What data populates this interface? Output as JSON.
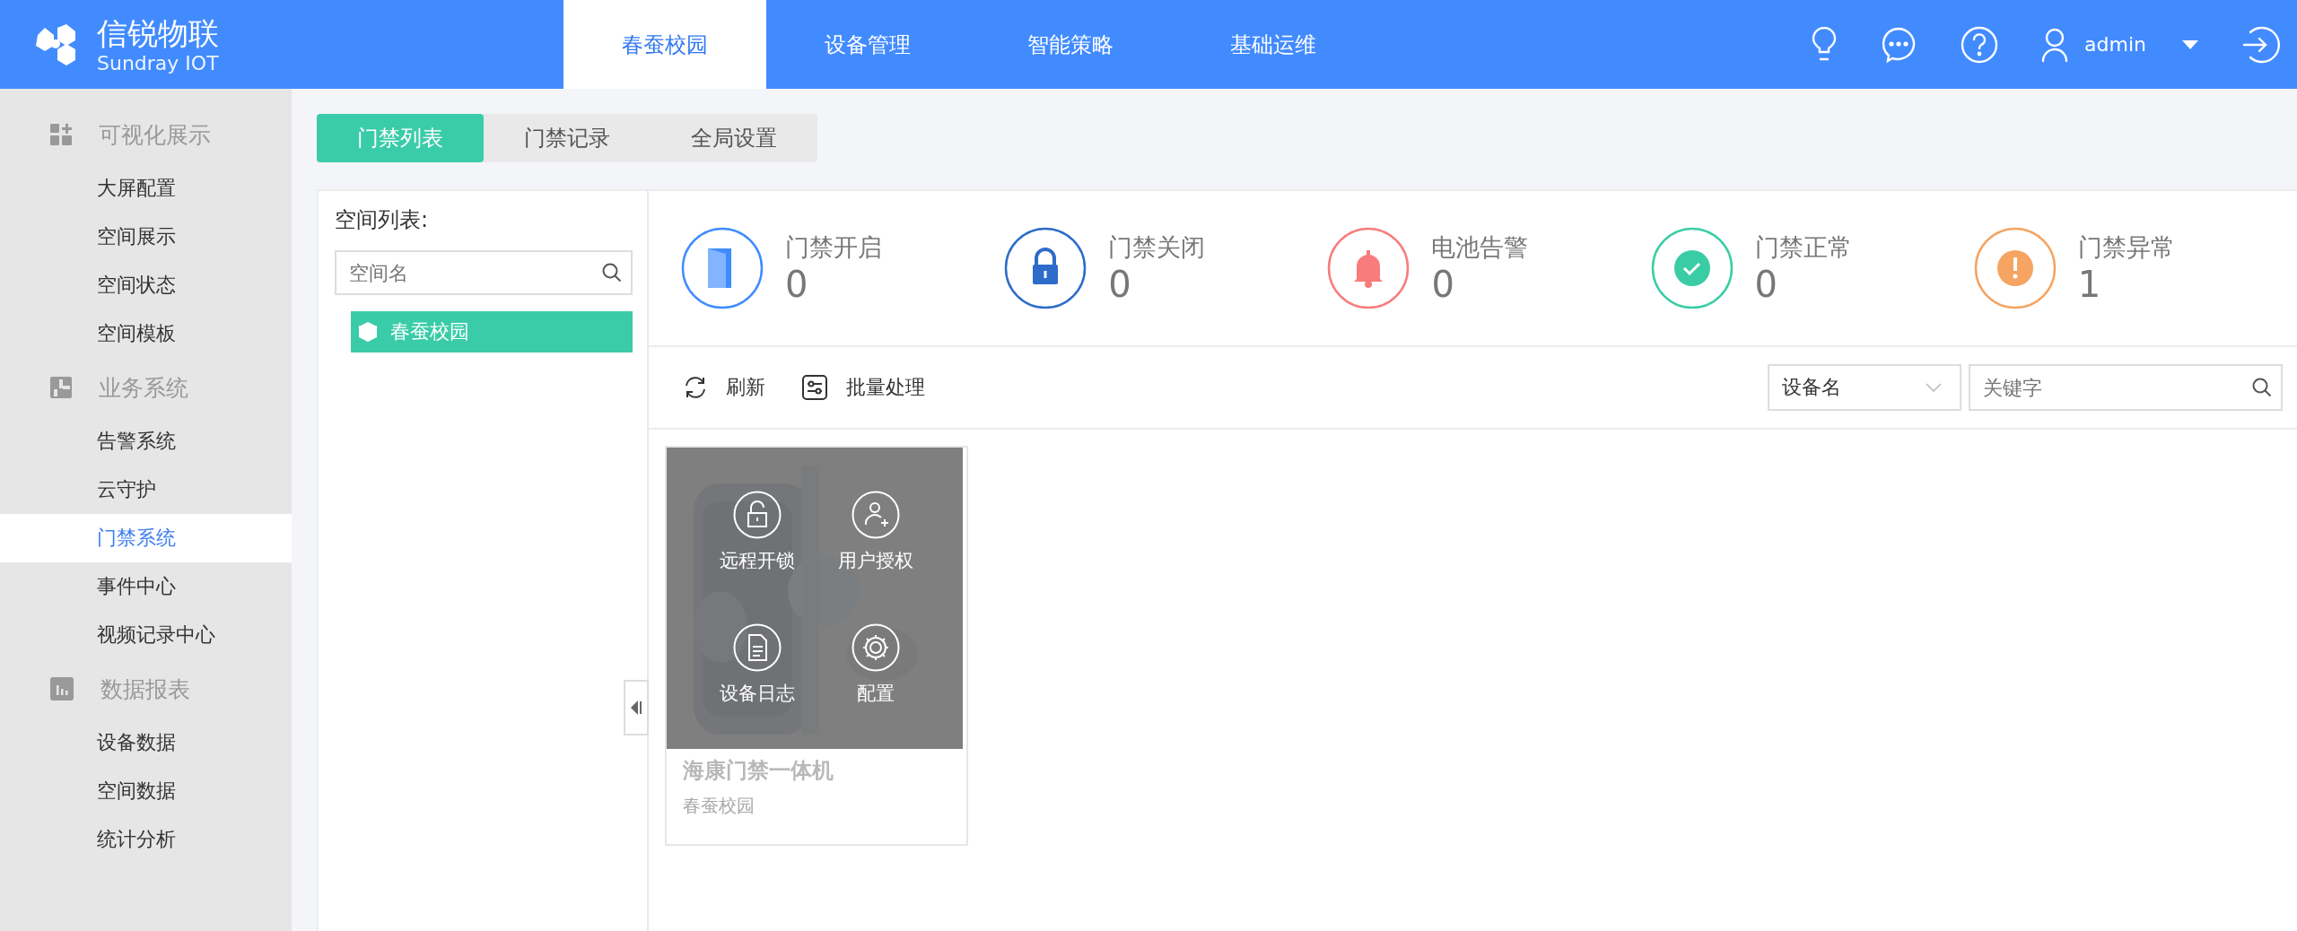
{
  "logo": {
    "name": "信锐物联",
    "subtitle": "Sundray IOT"
  },
  "nav": [
    {
      "label": "春蚕校园",
      "selected": true
    },
    {
      "label": "设备管理",
      "selected": false
    },
    {
      "label": "智能策略",
      "selected": false
    },
    {
      "label": "基础运维",
      "selected": false
    }
  ],
  "user": {
    "name": "admin"
  },
  "sidebar": [
    {
      "title": "可视化展示",
      "items": [
        {
          "label": "大屏配置",
          "selected": false
        },
        {
          "label": "空间展示",
          "selected": false
        },
        {
          "label": "空间状态",
          "selected": false
        },
        {
          "label": "空间模板",
          "selected": false
        }
      ]
    },
    {
      "title": "业务系统",
      "items": [
        {
          "label": "告警系统",
          "selected": false
        },
        {
          "label": "云守护",
          "selected": false
        },
        {
          "label": "门禁系统",
          "selected": true
        },
        {
          "label": "事件中心",
          "selected": false
        },
        {
          "label": "视频记录中心",
          "selected": false
        }
      ]
    },
    {
      "title": "数据报表",
      "items": [
        {
          "label": "设备数据",
          "selected": false
        },
        {
          "label": "空间数据",
          "selected": false
        },
        {
          "label": "统计分析",
          "selected": false
        }
      ]
    }
  ],
  "subtabs": [
    {
      "label": "门禁列表",
      "selected": true
    },
    {
      "label": "门禁记录",
      "selected": false
    },
    {
      "label": "全局设置",
      "selected": false
    }
  ],
  "space_panel": {
    "title": "空间列表:",
    "search": {
      "placeholder": "空间名"
    },
    "tree": [
      {
        "label": "春蚕校园",
        "selected": true
      }
    ]
  },
  "stats": [
    {
      "label": "门禁开启",
      "value": "0",
      "color": "#3f8cff"
    },
    {
      "label": "门禁关闭",
      "value": "0",
      "color": "#2d6cc9"
    },
    {
      "label": "电池告警",
      "value": "0",
      "color": "#f87c7c"
    },
    {
      "label": "门禁正常",
      "value": "0",
      "color": "#3acda5"
    },
    {
      "label": "门禁异常",
      "value": "1",
      "color": "#f5a462"
    }
  ],
  "toolbar": {
    "buttons": [
      "刷新",
      "批量处理"
    ],
    "filter": {
      "value": "设备名"
    },
    "keyword": {
      "placeholder": "关键字"
    }
  },
  "devices": [
    {
      "name": "海康门禁一体机",
      "location": "春蚕校园",
      "actions": [
        "远程开锁",
        "用户授权",
        "设备日志",
        "配置"
      ]
    }
  ]
}
